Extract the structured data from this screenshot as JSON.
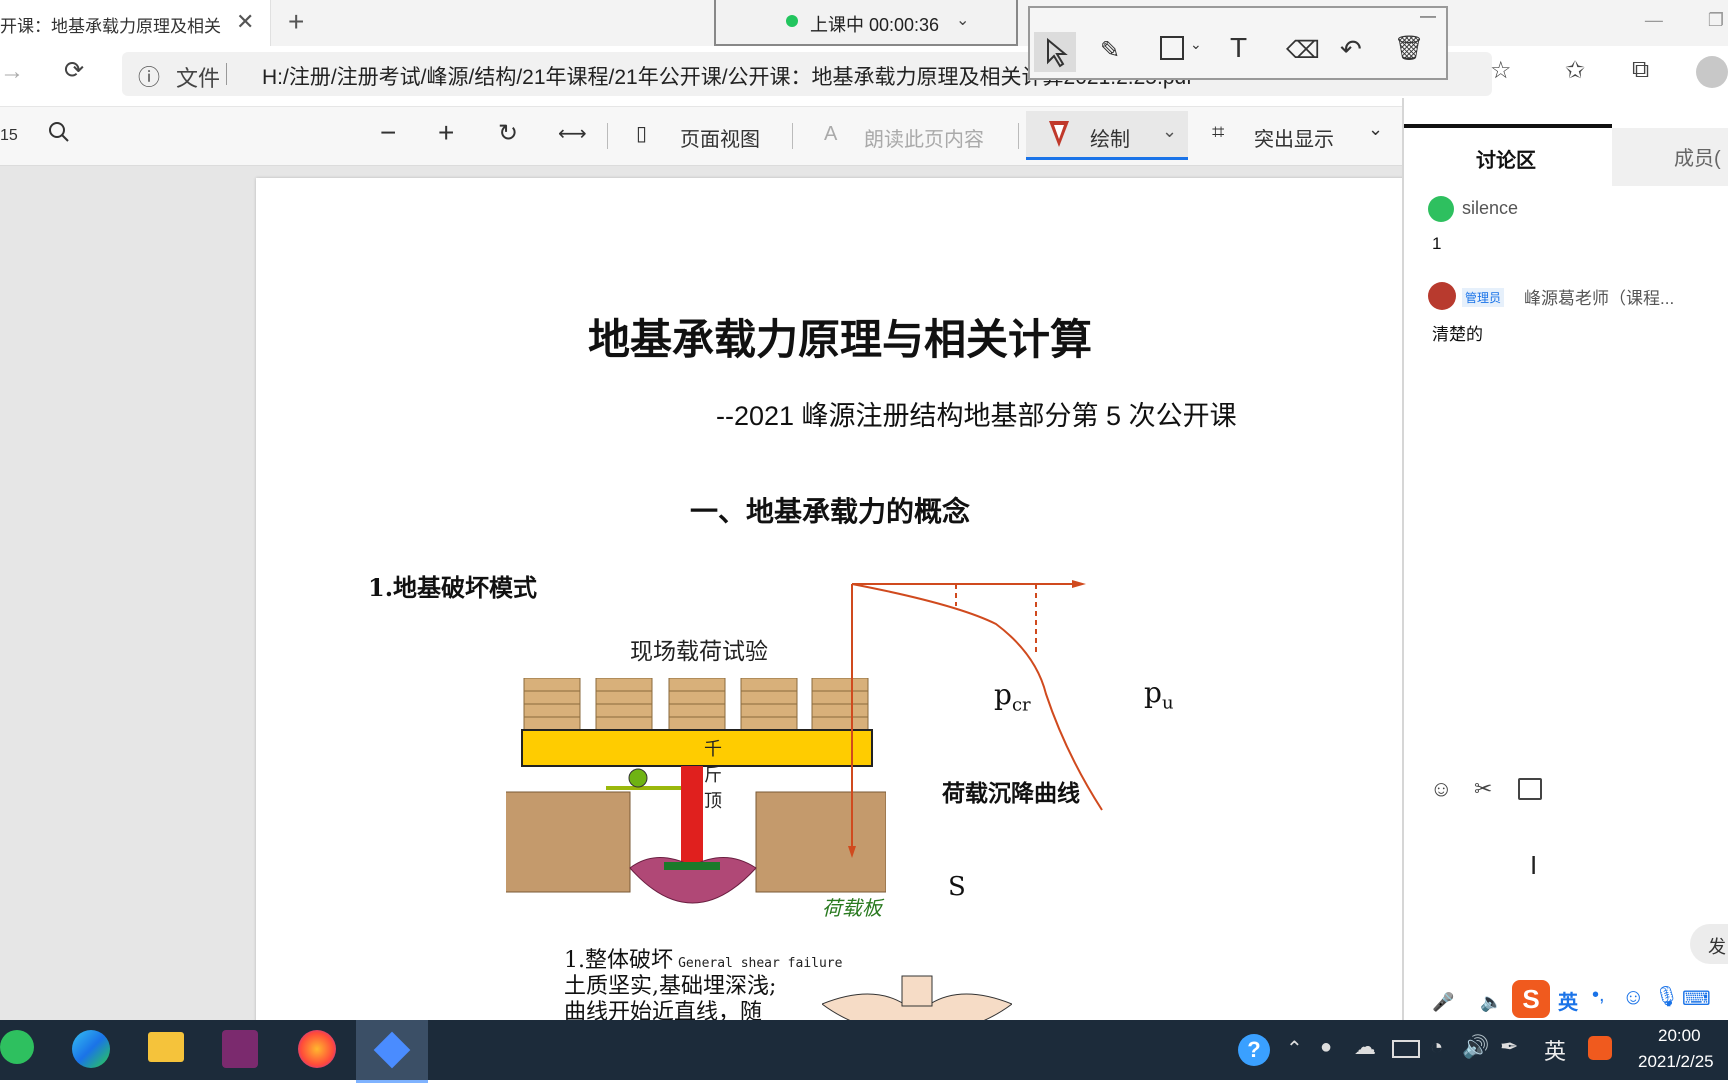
{
  "browser": {
    "tab_title": "开课：地基承载力原理及相关",
    "tab_close": "✕",
    "new_tab": "+",
    "address_info": "ⓘ",
    "address_label": "文件",
    "url": "H:/注册/注册考试/峰源/结构/21年课程/21年公开课/公开课：地基承载力原理及相关计算2021.2.25.pdf"
  },
  "pdf_toolbar": {
    "page_number": "15",
    "page_view_label": "页面视图",
    "read_aloud_label": "朗读此页内容",
    "draw_label": "绘制",
    "highlight_label": "突出显示"
  },
  "live_indicator": {
    "label": "上课中 00:00:36",
    "status_color": "#22c55e"
  },
  "document": {
    "title": "地基承载力原理与相关计算",
    "subtitle": "--2021 峰源注册结构地基部分第 5 次公开课",
    "section_heading": "一、地基承载力的概念",
    "subsection_heading": "1.地基破坏模式",
    "figure": {
      "caption_test": "现场载荷试验",
      "jack_label": "千斤顶",
      "plate_label": "荷载板",
      "curve_label": "荷载沉降曲线",
      "pcr_label": "p",
      "pcr_sub": "cr",
      "pu_label": "p",
      "pu_sub": "u",
      "s_label": "S"
    },
    "failure_title": "1.整体破坏",
    "failure_english": "General shear failure",
    "failure_line1": "土质坚实,基础埋深浅;",
    "failure_line2": "曲线开始近直线，随"
  },
  "panel": {
    "tab_discussion": "讨论区",
    "tab_members": "成员(",
    "messages": [
      {
        "user": "silence",
        "text": "1"
      },
      {
        "badge": "管理员",
        "user": "峰源葛老师（课程...",
        "text": "清楚的"
      }
    ],
    "send_label": "发"
  },
  "taskbar": {
    "ime_label": "英",
    "time": "20:00",
    "date": "2021/2/25"
  },
  "colors": {
    "accent_red": "#c0392b",
    "draw_underline": "#1a73e8",
    "plate_yellow": "#ffcc00",
    "taskbar": "#1c2b3a"
  }
}
